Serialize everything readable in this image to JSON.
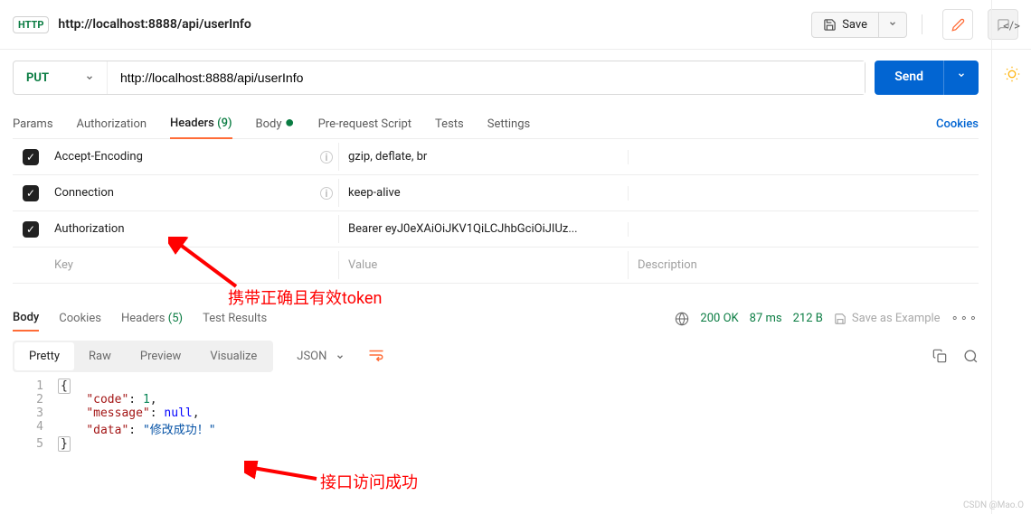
{
  "topbar": {
    "badge": "HTTP",
    "title": "http://localhost:8888/api/userInfo",
    "save_label": "Save"
  },
  "request": {
    "method": "PUT",
    "url": "http://localhost:8888/api/userInfo",
    "send_label": "Send"
  },
  "req_tabs": {
    "params": "Params",
    "auth": "Authorization",
    "headers": "Headers",
    "headers_count": "(9)",
    "body": "Body",
    "prereq": "Pre-request Script",
    "tests": "Tests",
    "settings": "Settings",
    "cookies": "Cookies"
  },
  "headers": {
    "rows": [
      {
        "key": "Accept-Encoding",
        "value": "gzip, deflate, br",
        "info": true
      },
      {
        "key": "Connection",
        "value": "keep-alive",
        "info": true
      },
      {
        "key": "Authorization",
        "value": "Bearer eyJ0eXAiOiJKV1QiLCJhbGciOiJIUz...",
        "info": false
      }
    ],
    "placeholders": {
      "key": "Key",
      "value": "Value",
      "desc": "Description"
    }
  },
  "annotation1": "携带正确且有效token",
  "annotation2": "接口访问成功",
  "response_tabs": {
    "body": "Body",
    "cookies": "Cookies",
    "headers": "Headers",
    "headers_count": "(5)",
    "testresults": "Test Results"
  },
  "status": {
    "code": "200 OK",
    "time": "87 ms",
    "size": "212 B",
    "save_example": "Save as Example"
  },
  "view": {
    "pretty": "Pretty",
    "raw": "Raw",
    "preview": "Preview",
    "visualize": "Visualize",
    "format": "JSON"
  },
  "json_body": {
    "l1": "{",
    "l2k": "\"code\"",
    "l2v": "1",
    "l3k": "\"message\"",
    "l3v": "null",
    "l4k": "\"data\"",
    "l4v": "\"修改成功！\"",
    "l5": "}"
  },
  "watermark": "CSDN @Mao.O"
}
